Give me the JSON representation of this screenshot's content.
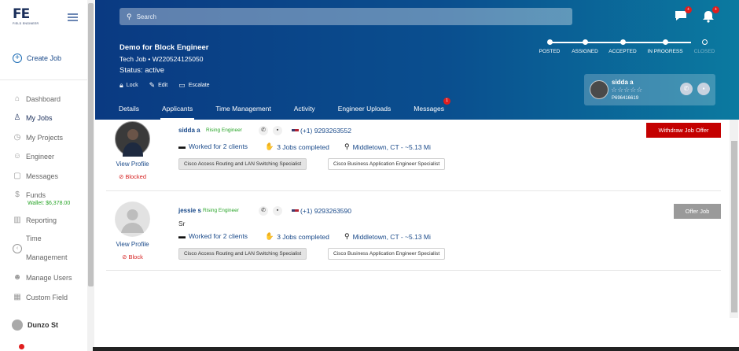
{
  "sidebar": {
    "logo_text": "FE",
    "logo_sub": "FIELD ENGINEER",
    "create_job": "Create Job",
    "items": [
      {
        "label": "Dashboard",
        "icon": "home-icon"
      },
      {
        "label": "My Jobs",
        "icon": "engineer-icon"
      },
      {
        "label": "My Projects",
        "icon": "clock-icon"
      },
      {
        "label": "Engineer",
        "icon": "people-icon"
      },
      {
        "label": "Messages",
        "icon": "chat-icon"
      },
      {
        "label": "Funds",
        "icon": "dollar-icon"
      },
      {
        "label": "Reporting",
        "icon": "chart-icon"
      },
      {
        "label": "Manage Users",
        "icon": "users-icon"
      },
      {
        "label": "Custom Field",
        "icon": "calendar-icon"
      }
    ],
    "wallet": "Wallet: $6,378.00",
    "time_label_1": "Time",
    "time_label_2": "Management",
    "user_name": "Dunzo St"
  },
  "header": {
    "search_placeholder": "Search",
    "chat_badge": "+",
    "bell_badge": "+",
    "job_title": "Demo for Block Engineer",
    "job_sub": "Tech Job • W220524125050",
    "job_status": "Status: active",
    "actions": [
      {
        "label": "Lock",
        "icon": "lock-icon"
      },
      {
        "label": "Edit",
        "icon": "edit-icon"
      },
      {
        "label": "Escalate",
        "icon": "escalate-icon"
      }
    ],
    "tabs": [
      {
        "label": "Details"
      },
      {
        "label": "Applicants"
      },
      {
        "label": "Time Management"
      },
      {
        "label": "Activity"
      },
      {
        "label": "Engineer Uploads"
      },
      {
        "label": "Messages",
        "badge": "1"
      }
    ],
    "progress_steps": [
      {
        "label": "POSTED",
        "done": true
      },
      {
        "label": "ASSIGNED",
        "done": true
      },
      {
        "label": "ACCEPTED",
        "done": true
      },
      {
        "label": "IN PROGRESS",
        "done": true
      },
      {
        "label": "CLOSED",
        "done": false
      }
    ],
    "engineer_card": {
      "name": "sidda a",
      "stars": "☆☆☆☆☆",
      "id": "P696416619"
    }
  },
  "applicants": [
    {
      "name": "sidda a",
      "level": "Rising Engineer",
      "phone": "(+1) 9293263552",
      "subtitle": "",
      "clients": "Worked for 2 clients",
      "jobs": "3 Jobs completed",
      "location": "Middletown, CT -  ~5.13 Mi",
      "tags": [
        "Cisco Access Routing and LAN Switching Specialist",
        "Cisco Business Application Engineer Specialist"
      ],
      "view_profile": "View Profile",
      "block_status": "⊘ Blocked",
      "action_label": "Withdraw Job Offer"
    },
    {
      "name": "jessie s",
      "level": "Rising Engineer",
      "phone": "(+1) 9293263590",
      "subtitle": "Sr",
      "clients": "Worked for 2 clients",
      "jobs": "3 Jobs completed",
      "location": "Middletown, CT -  ~5.13 Mi",
      "tags": [
        "Cisco Access Routing and LAN Switching Specialist",
        "Cisco Business Application Engineer Specialist"
      ],
      "view_profile": "View Profile",
      "block_status": "⊘ Block",
      "action_label": "Offer Job"
    }
  ],
  "colors": {
    "header_start": "#0a3a82",
    "header_end": "#0b7aa0",
    "withdraw": "#c40000",
    "offer": "#9a9a9a",
    "rising": "#2aa52a",
    "blocked": "#d62424"
  }
}
